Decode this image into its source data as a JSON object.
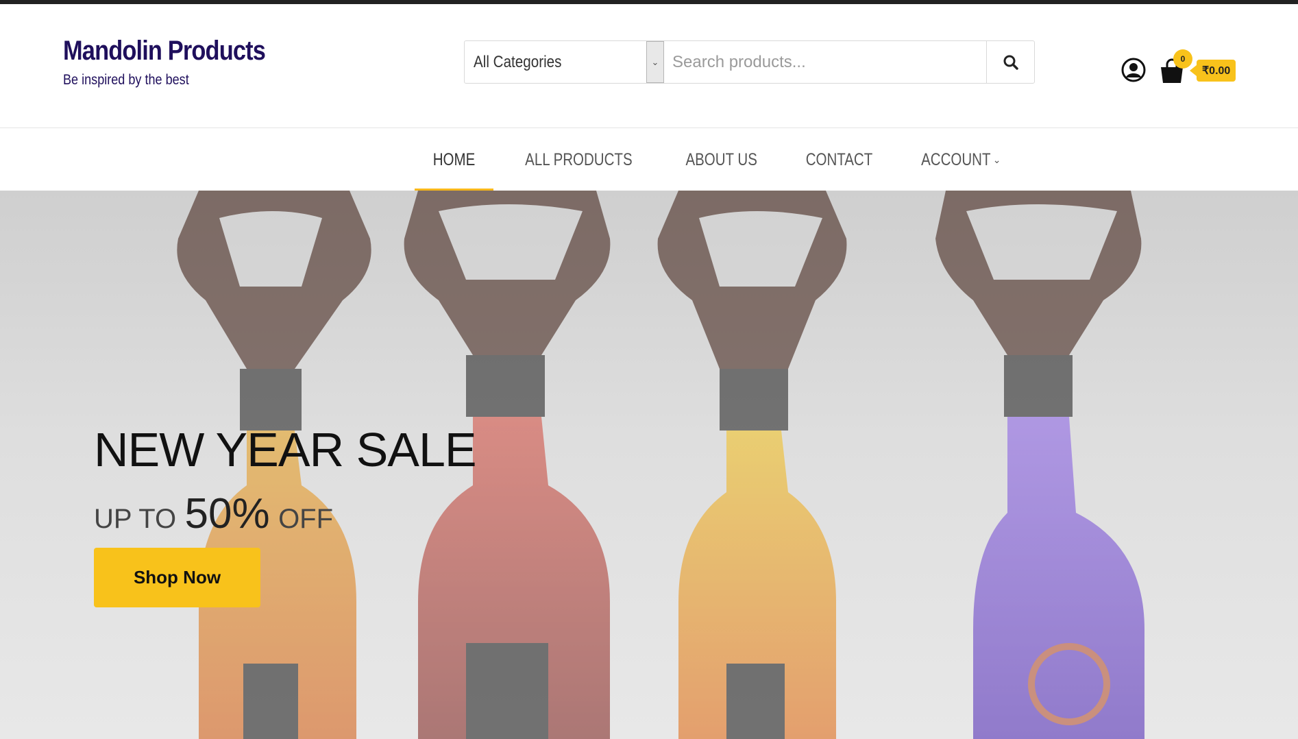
{
  "brand": {
    "title": "Mandolin Products",
    "tagline": "Be inspired by the best"
  },
  "search": {
    "category": "All Categories",
    "placeholder": "Search products...",
    "value": ""
  },
  "cart": {
    "count": "0",
    "total": "₹0.00"
  },
  "nav": {
    "items": [
      {
        "label": "HOME",
        "active": true
      },
      {
        "label": "ALL PRODUCTS"
      },
      {
        "label": "ABOUT US"
      },
      {
        "label": "CONTACT"
      },
      {
        "label": "ACCOUNT",
        "has_dropdown": true
      }
    ]
  },
  "hero": {
    "title": "NEW YEAR SALE",
    "sub_prefix": "UP TO",
    "sub_value": "50%",
    "sub_suffix": "OFF",
    "button_label": "Shop Now"
  },
  "colors": {
    "brand": "#1f0f5c",
    "accent": "#f8c21b",
    "nav_underline": "#f8b81b"
  }
}
